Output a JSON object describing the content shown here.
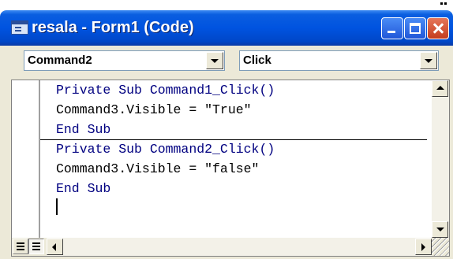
{
  "window": {
    "title": "resala - Form1 (Code)"
  },
  "toolbar": {
    "object_combo": "Command2",
    "procedure_combo": "Click"
  },
  "code": {
    "lines": [
      "Private Sub Command1_Click()",
      "Command3.Visible = \"True\"",
      "End Sub",
      "Private Sub Command2_Click()",
      "Command3.Visible = \"false\"",
      "End Sub"
    ]
  },
  "colors": {
    "titlebar": "#0054e3",
    "keyword": "#000080",
    "close_button": "#d6512f"
  },
  "icons": {
    "app": "vb-code-window-icon",
    "minimize": "minimize-icon",
    "maximize": "maximize-icon",
    "close": "close-icon"
  }
}
